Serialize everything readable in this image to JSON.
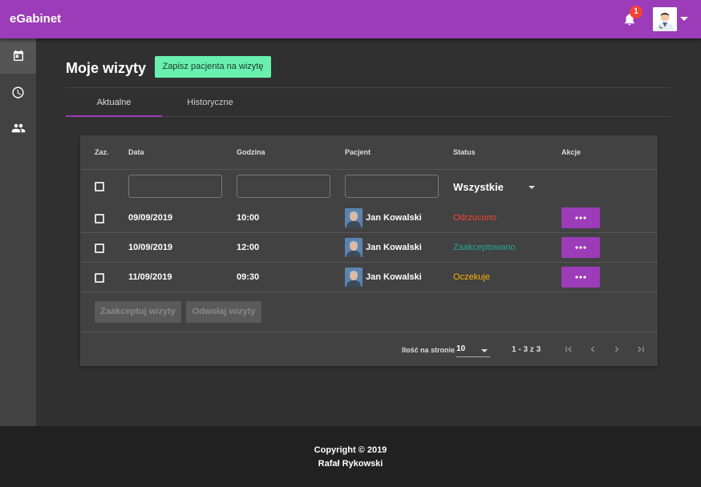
{
  "app": {
    "title": "eGabinet"
  },
  "header": {
    "notification_count": "1"
  },
  "sidebar": {
    "items": [
      {
        "icon": "calendar-icon"
      },
      {
        "icon": "clock-icon"
      },
      {
        "icon": "people-icon"
      }
    ]
  },
  "page": {
    "title": "Moje wizyty",
    "add_button": "Zapisz pacjenta na wizytę"
  },
  "tabs": [
    {
      "label": "Aktualne"
    },
    {
      "label": "Historyczne"
    }
  ],
  "table": {
    "headers": {
      "select": "Zaz.",
      "date": "Data",
      "time": "Godzina",
      "patient": "Pacjent",
      "status": "Status",
      "actions": "Akcje"
    },
    "filters": {
      "status_value": "Wszystkie"
    },
    "rows": [
      {
        "date": "09/09/2019",
        "time": "10:00",
        "patient": "Jan Kowalski",
        "status": "Odrzucono",
        "status_color": "#f44336"
      },
      {
        "date": "10/09/2019",
        "time": "12:00",
        "patient": "Jan Kowalski",
        "status": "Zaakceptowano",
        "status_color": "#26a69a"
      },
      {
        "date": "11/09/2019",
        "time": "09:30",
        "patient": "Jan Kowalski",
        "status": "Oczekuje",
        "status_color": "#ffb300"
      }
    ],
    "bulk_actions": {
      "accept": "Zaakceptuj wizyty",
      "cancel": "Odwołaj wizyty"
    },
    "pager": {
      "label": "Ilość na stronie",
      "page_size": "10",
      "range": "1 - 3 z 3"
    }
  },
  "footer": {
    "line1": "Copyright © 2019",
    "line2": "Rafał Rykowski"
  },
  "colors": {
    "accent": "#9c3cb8",
    "primary_button": "#69f0ae"
  }
}
